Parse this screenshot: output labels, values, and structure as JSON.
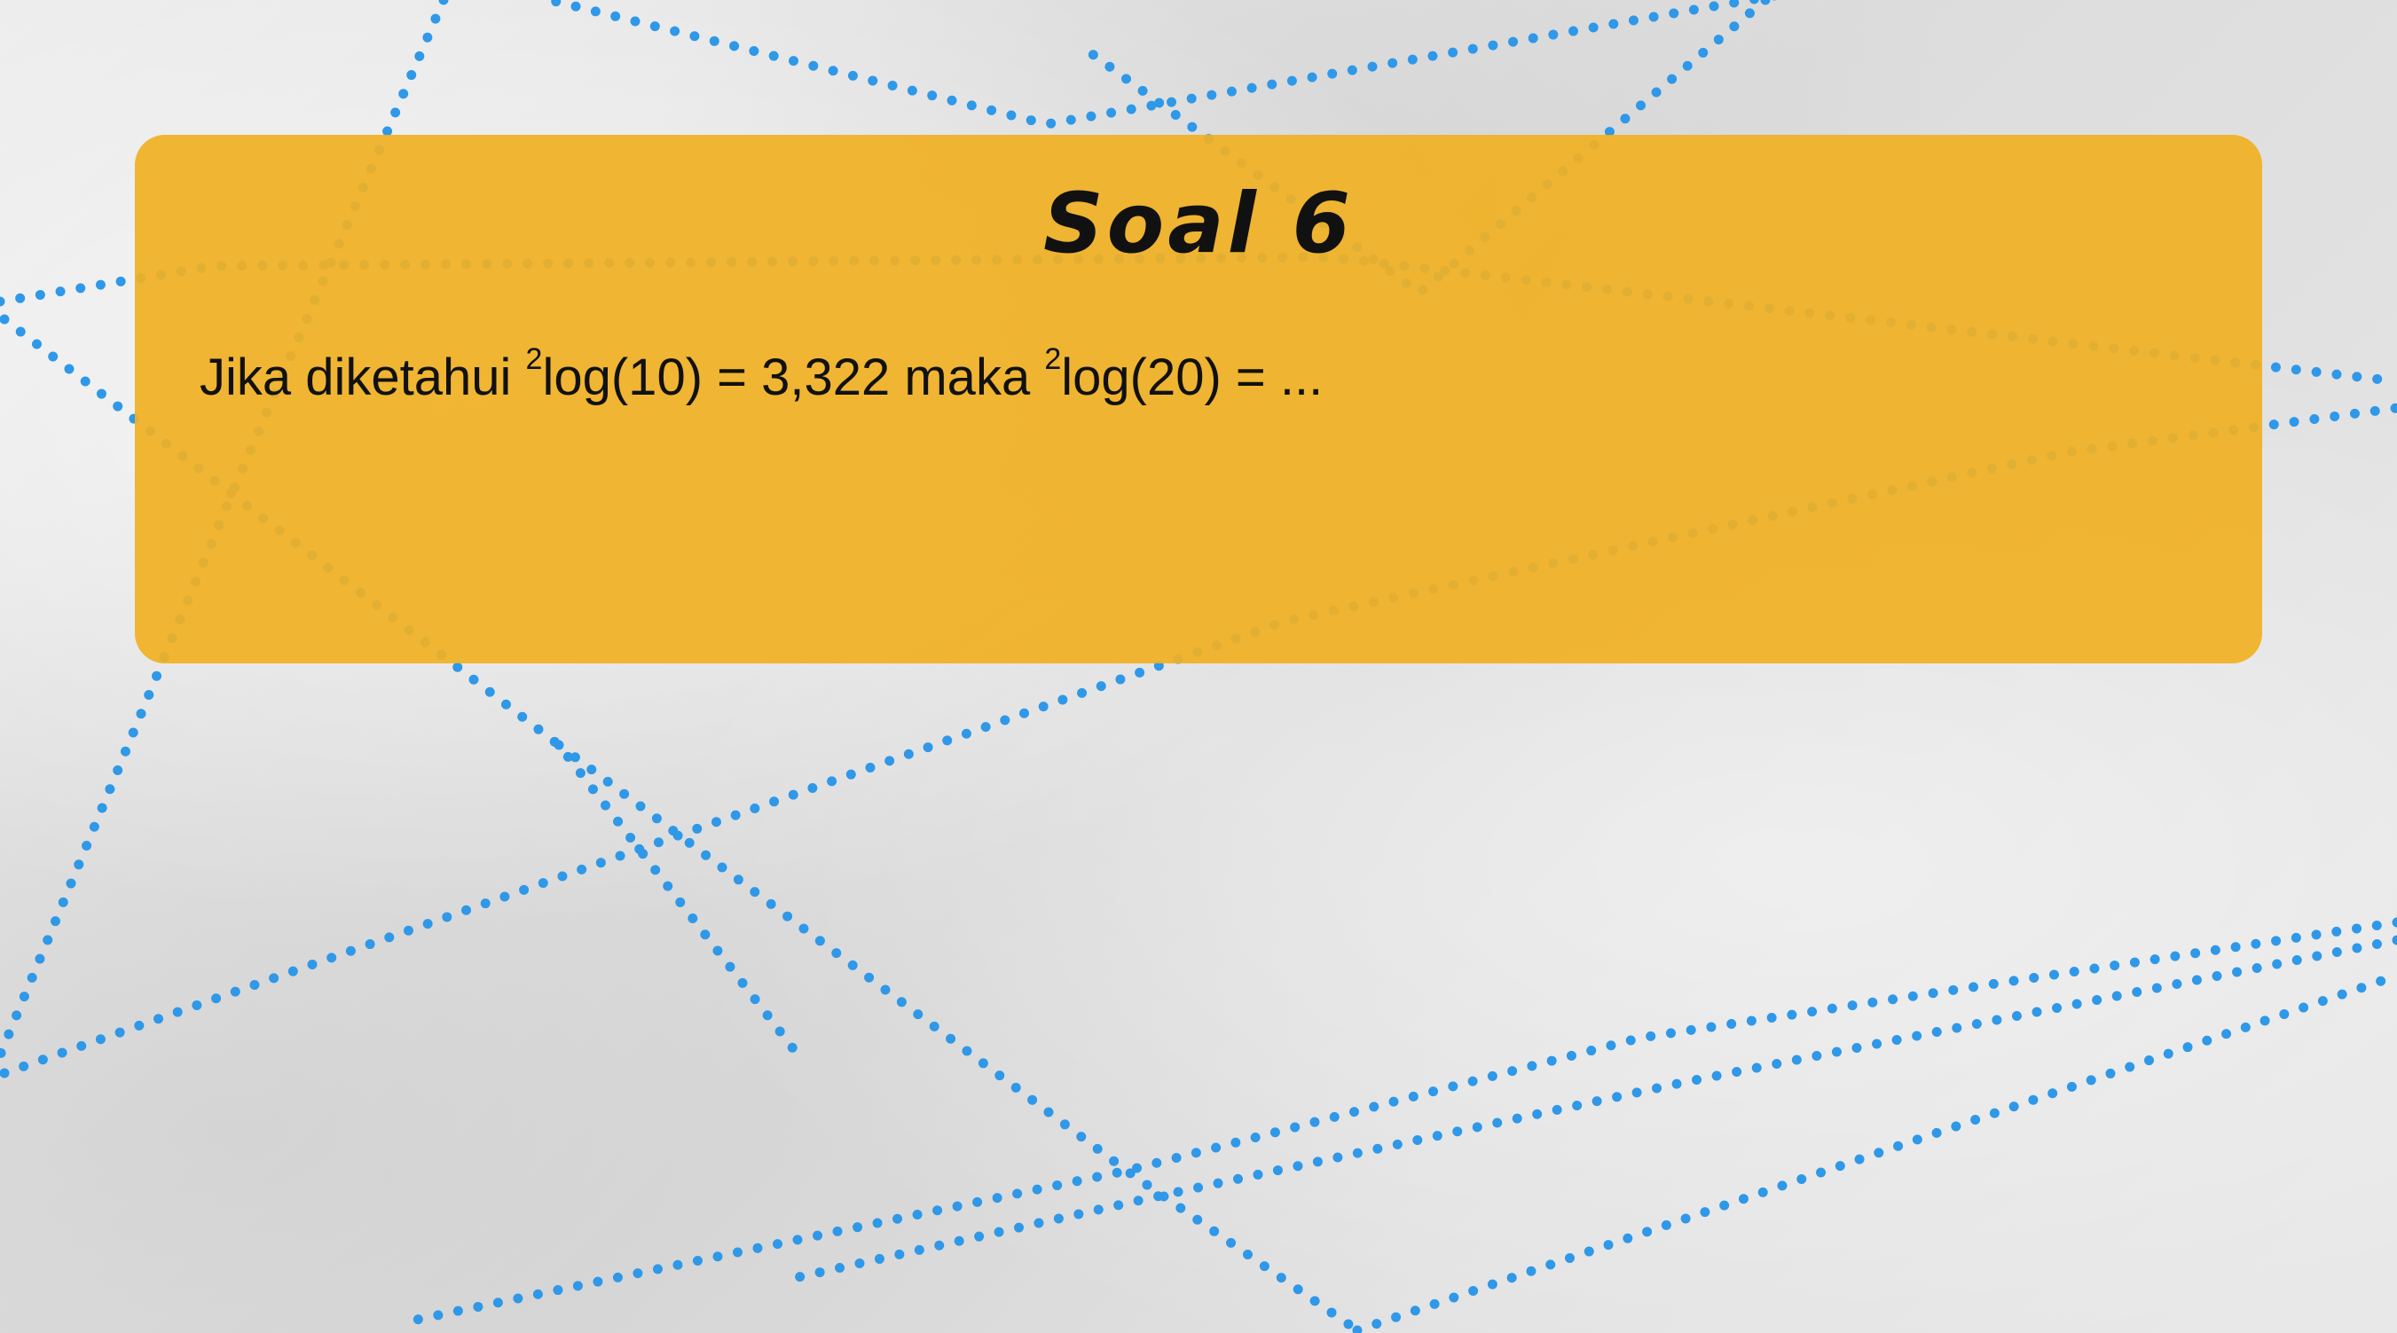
{
  "slide": {
    "title": "Soal 6",
    "question": {
      "intro": "Jika diketahui ",
      "base1": "2",
      "expr1": "log(10) = 3,322 maka ",
      "base2": "2",
      "expr2": "log(20) = ..."
    }
  },
  "colors": {
    "background": "#e4e4e4",
    "card": "#f0b023",
    "dots": "#2f98e8",
    "text": "#111111"
  }
}
